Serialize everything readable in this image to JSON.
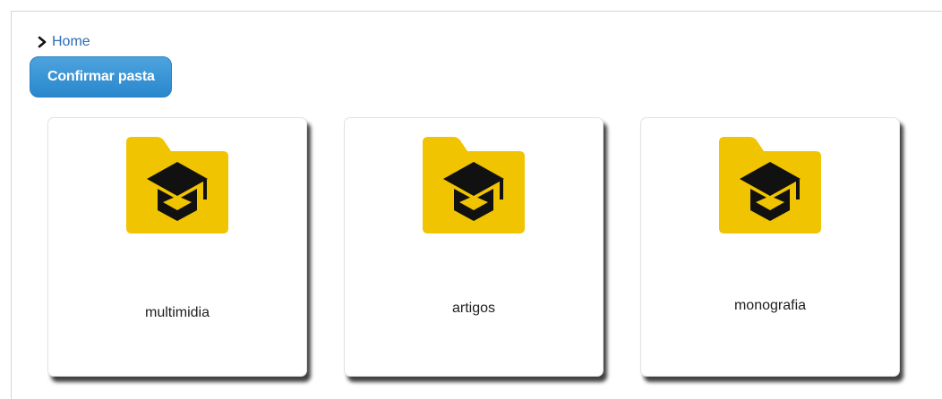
{
  "breadcrumb": {
    "items": [
      {
        "label": "Home"
      }
    ]
  },
  "actions": {
    "confirm_label": "Confirmar pasta"
  },
  "folders": [
    {
      "name": "multimidia",
      "icon": "graduation-cap-folder-icon"
    },
    {
      "name": "artigos",
      "icon": "graduation-cap-folder-icon"
    },
    {
      "name": "monografia",
      "icon": "graduation-cap-folder-icon"
    }
  ],
  "colors": {
    "folder": "#f0c400",
    "icon_glyph": "#111111",
    "link": "#2c6db4",
    "button": "#2987cc"
  }
}
